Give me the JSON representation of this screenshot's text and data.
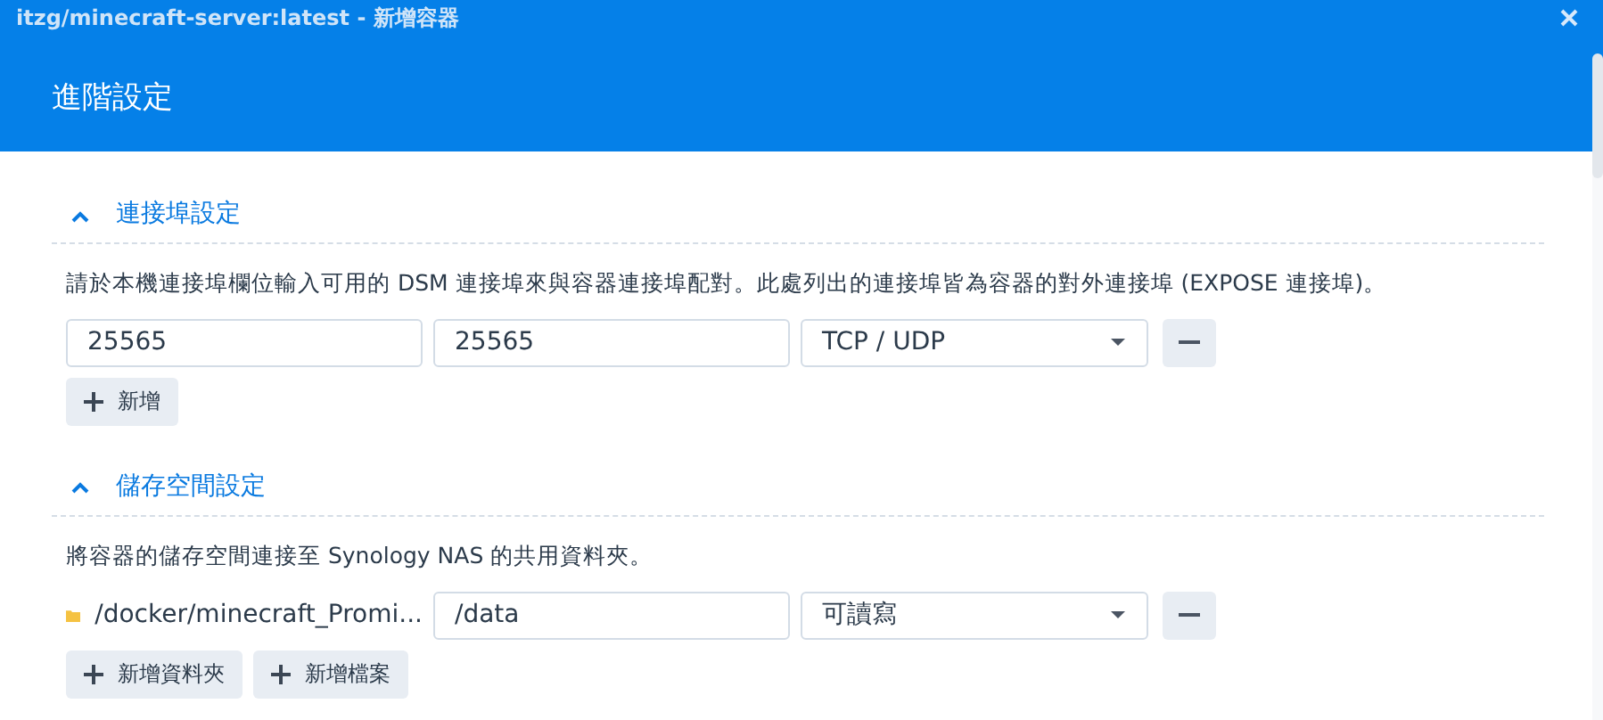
{
  "window": {
    "title": "itzg/minecraft-server:latest - 新增容器"
  },
  "header": {
    "title": "進階設定"
  },
  "sections": [
    {
      "title": "連接埠設定",
      "expanded": true,
      "description": "請於本機連接埠欄位輸入可用的 DSM 連接埠來與容器連接埠配對。此處列出的連接埠皆為容器的對外連接埠 (EXPOSE 連接埠)。",
      "rows": [
        {
          "kind": "port",
          "local": "25565",
          "container": "25565",
          "option": "TCP / UDP"
        }
      ],
      "buttons": [
        "新增"
      ]
    },
    {
      "title": "儲存空間設定",
      "expanded": true,
      "description": "將容器的儲存空間連接至 Synology NAS 的共用資料夾。",
      "rows": [
        {
          "kind": "folder",
          "local": "/docker/minecraft_Promi...",
          "container": "/data",
          "option": "可讀寫"
        }
      ],
      "buttons": [
        "新增資料夾",
        "新增檔案"
      ]
    }
  ]
}
